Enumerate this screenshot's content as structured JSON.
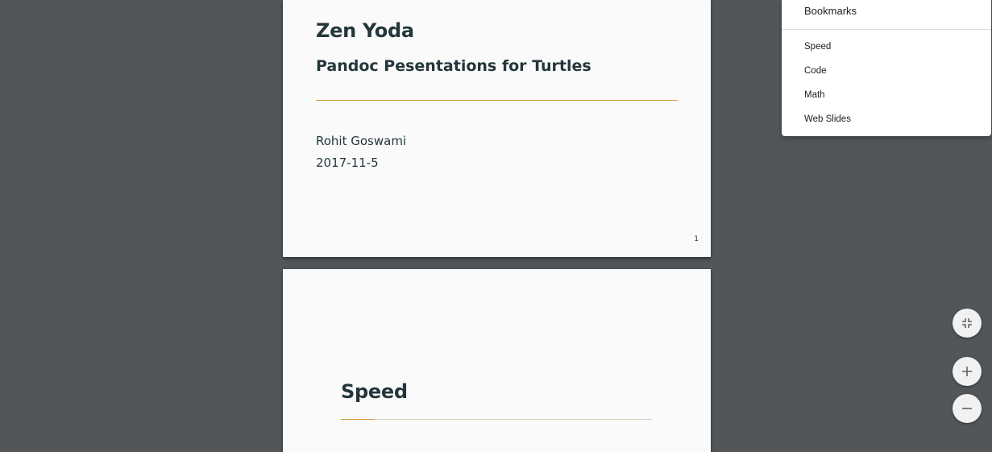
{
  "slides": [
    {
      "title": "Zen Yoda",
      "subtitle": "Pandoc Pesentations for Turtles",
      "author": "Rohit Goswami",
      "date": "2017-11-5",
      "page_number": "1"
    },
    {
      "section_title": "Speed",
      "section_progress": 0.105
    }
  ],
  "bookmarks": {
    "header": "Bookmarks",
    "items": [
      "Speed",
      "Code",
      "Math",
      "Web Slides"
    ]
  },
  "controls": {
    "fit_icon": "fit-to-page-icon",
    "zoom_in_icon": "zoom-in-icon",
    "zoom_out_icon": "zoom-out-icon"
  },
  "colors": {
    "viewer_background": "#525659",
    "slide_background": "#fafafa",
    "text": "#23373b",
    "accent": "#d59a3a"
  }
}
